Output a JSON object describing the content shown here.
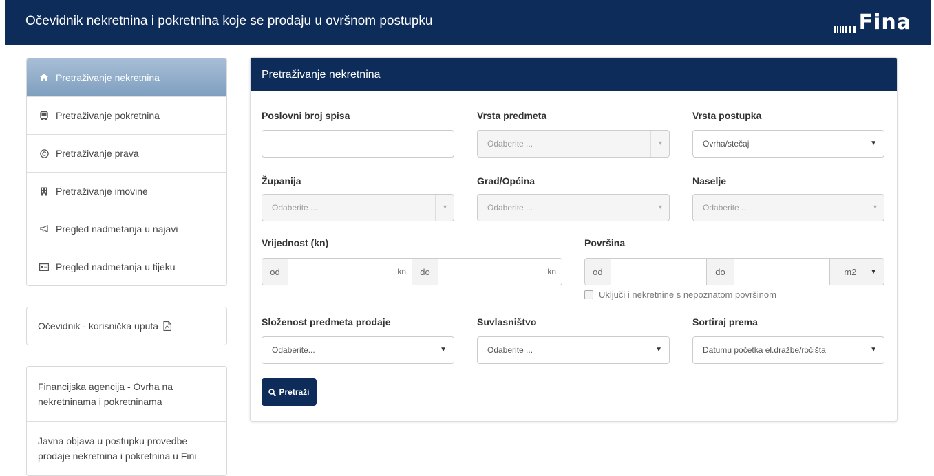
{
  "header": {
    "title": "Očevidnik nekretnina i pokretnina koje se prodaju u ovršnom postupku",
    "logo_text": "Fina"
  },
  "sidebar": {
    "items": [
      {
        "label": "Pretraživanje nekretnina",
        "icon": "home-icon",
        "active": true
      },
      {
        "label": "Pretraživanje pokretnina",
        "icon": "bus-icon",
        "active": false
      },
      {
        "label": "Pretraživanje prava",
        "icon": "copyright-icon",
        "active": false
      },
      {
        "label": "Pretraživanje imovine",
        "icon": "building-icon",
        "active": false
      },
      {
        "label": "Pregled nadmetanja u najavi",
        "icon": "megaphone-icon",
        "active": false
      },
      {
        "label": "Pregled nadmetanja u tijeku",
        "icon": "id-card-icon",
        "active": false
      }
    ],
    "manual": {
      "label": "Očevidnik - korisnička uputa",
      "icon": "pdf-icon"
    },
    "links": [
      {
        "label": "Financijska agencija - Ovrha na nekretninama i pokretninama"
      },
      {
        "label": "Javna objava u postupku provedbe prodaje nekretnina i pokretnina u Fini"
      }
    ]
  },
  "panel": {
    "title": "Pretraživanje nekretnina",
    "fields": {
      "poslovni_broj": {
        "label": "Poslovni broj spisa",
        "value": ""
      },
      "vrsta_predmeta": {
        "label": "Vrsta predmeta",
        "placeholder": "Odaberite ..."
      },
      "vrsta_postupka": {
        "label": "Vrsta postupka",
        "value": "Ovrha/stečaj"
      },
      "zupanija": {
        "label": "Županija",
        "placeholder": "Odaberite ..."
      },
      "grad": {
        "label": "Grad/Općina",
        "placeholder": "Odaberite ..."
      },
      "naselje": {
        "label": "Naselje",
        "placeholder": "Odaberite ..."
      },
      "vrijednost": {
        "label": "Vrijednost (kn)",
        "od": "od",
        "do": "do",
        "unit": "kn"
      },
      "povrsina": {
        "label": "Površina",
        "od": "od",
        "do": "do",
        "unit": "m2"
      },
      "nepoznata": {
        "label": "Uključi i nekretnine s nepoznatom površinom",
        "checked": false
      },
      "slozenost": {
        "label": "Složenost predmeta prodaje",
        "value": "Odaberite..."
      },
      "suvlasnistvo": {
        "label": "Suvlasništvo",
        "value": "Odaberite ..."
      },
      "sortiraj": {
        "label": "Sortiraj prema",
        "value": "Datumu početka el.dražbe/ročišta"
      }
    },
    "search_button": "Pretraži"
  },
  "colors": {
    "brand_navy": "#0d2c5a",
    "active_nav": "#8fabc8"
  }
}
